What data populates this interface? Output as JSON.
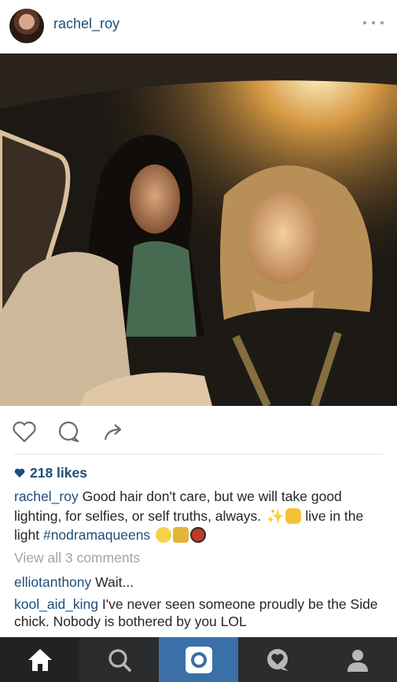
{
  "post": {
    "username": "rachel_roy",
    "likes_text": "218 likes",
    "caption": {
      "username": "rachel_roy",
      "text": " Good hair don't care, but we will take good lighting, for selfies, or self truths, always. ",
      "text2": " live in the light ",
      "hashtag": "#nodramaqueens"
    },
    "view_all_comments": "View all 3 comments",
    "comments": [
      {
        "username": "elliotanthony",
        "text": " Wait..."
      },
      {
        "username": "kool_aid_king",
        "text": " I've never seen someone proudly be the Side chick. Nobody is bothered by you LOL"
      }
    ]
  },
  "icons": {
    "more": "more-icon",
    "like": "heart-icon",
    "comment": "comment-icon",
    "share": "share-icon",
    "tabs": [
      "home-icon",
      "search-icon",
      "camera-icon",
      "activity-icon",
      "profile-icon"
    ]
  },
  "colors": {
    "link": "#1d4e7a",
    "muted": "#a3a3a3",
    "tabbar": "#2a2c2e",
    "active_tab": "#3b6fa8"
  }
}
